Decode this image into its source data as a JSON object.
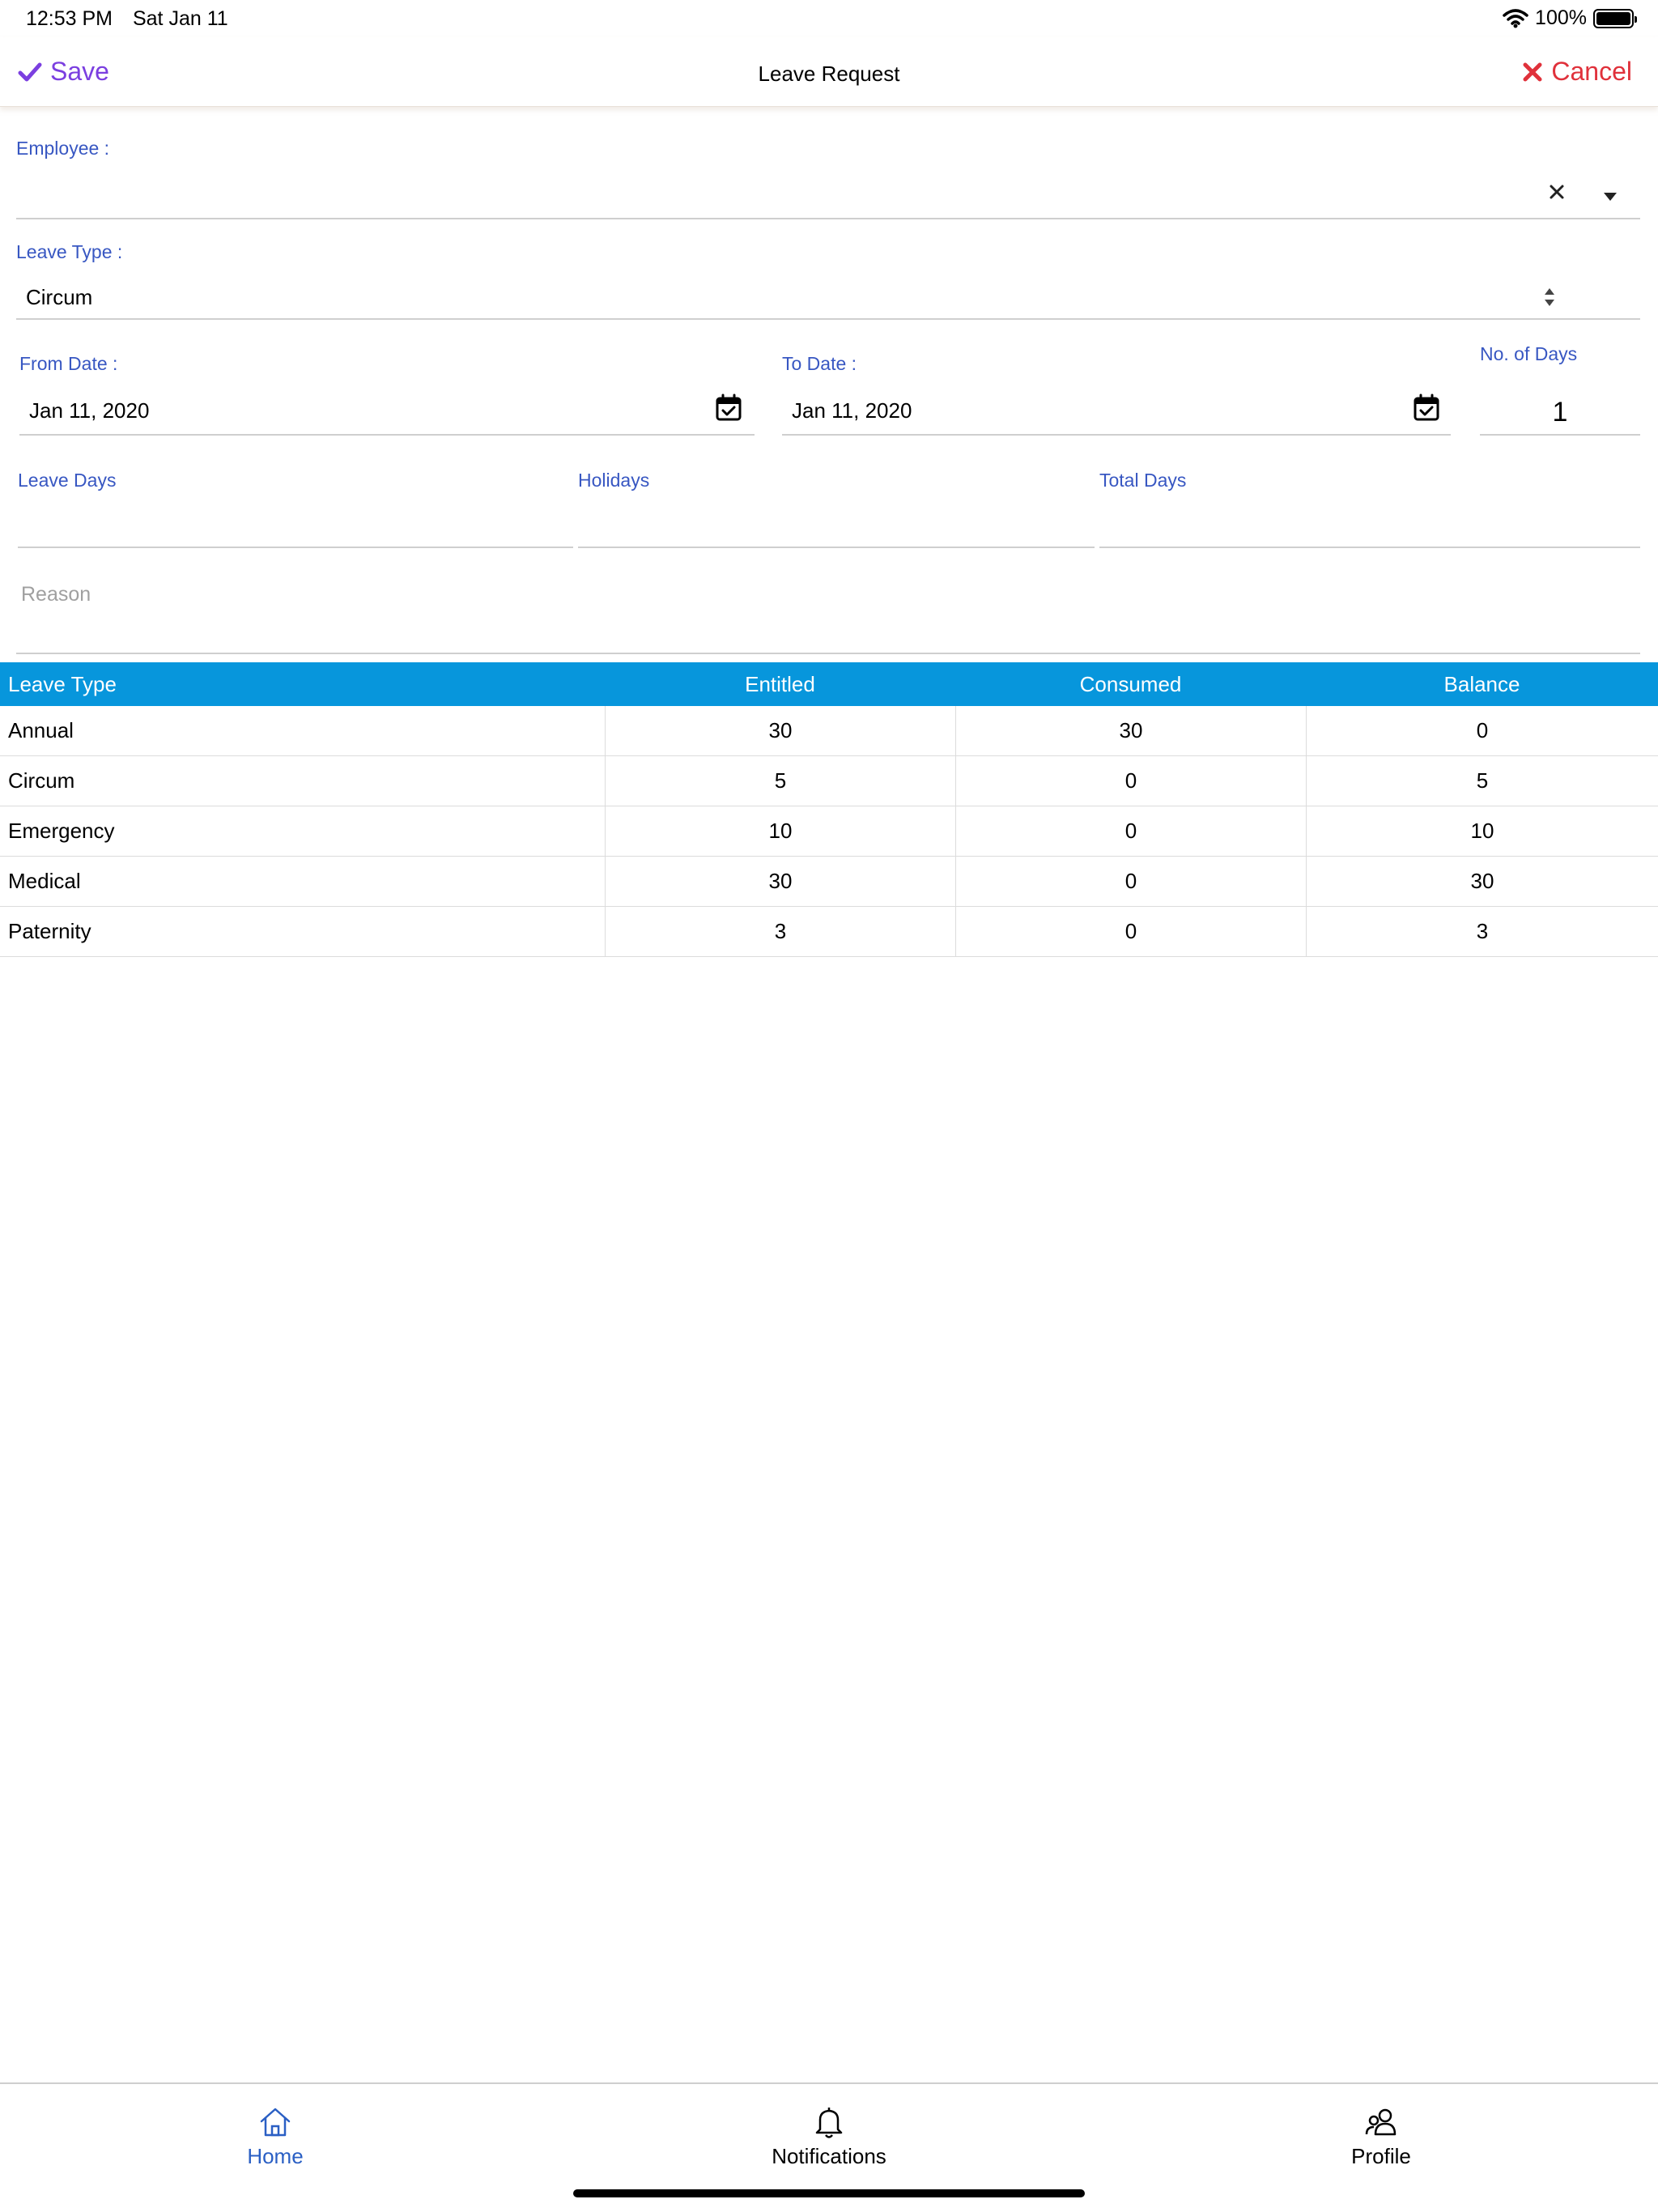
{
  "status_bar": {
    "time": "12:53 PM",
    "date": "Sat Jan 11",
    "battery": "100%"
  },
  "nav": {
    "save_label": "Save",
    "title": "Leave Request",
    "cancel_label": "Cancel"
  },
  "form": {
    "employee": {
      "label": "Employee :",
      "value": ""
    },
    "leave_type": {
      "label": "Leave Type :",
      "value": "Circum"
    },
    "from_date": {
      "label": "From Date :",
      "value": "Jan 11, 2020"
    },
    "to_date": {
      "label": "To Date :",
      "value": "Jan 11, 2020"
    },
    "no_of_days": {
      "label": "No. of Days",
      "value": "1"
    },
    "leave_days": {
      "label": "Leave Days",
      "value": ""
    },
    "holidays": {
      "label": "Holidays",
      "value": ""
    },
    "total_days": {
      "label": "Total Days",
      "value": ""
    },
    "reason": {
      "placeholder": "Reason"
    }
  },
  "balance_table": {
    "headers": [
      "Leave Type",
      "Entitled",
      "Consumed",
      "Balance"
    ],
    "rows": [
      [
        "Annual",
        "30",
        "30",
        "0"
      ],
      [
        "Circum",
        "5",
        "0",
        "5"
      ],
      [
        "Emergency",
        "10",
        "0",
        "10"
      ],
      [
        "Medical",
        "30",
        "0",
        "30"
      ],
      [
        "Paternity",
        "3",
        "0",
        "3"
      ]
    ]
  },
  "tabs": [
    {
      "label": "Home",
      "icon": "home-icon",
      "active": true
    },
    {
      "label": "Notifications",
      "icon": "bell-icon",
      "active": false
    },
    {
      "label": "Profile",
      "icon": "users-icon",
      "active": false
    }
  ],
  "colors": {
    "accent": "#7b3fe0",
    "cancel": "#e0313b",
    "label": "#3857c2",
    "table_header": "#0796dc",
    "tab_active": "#2a5fc4"
  }
}
